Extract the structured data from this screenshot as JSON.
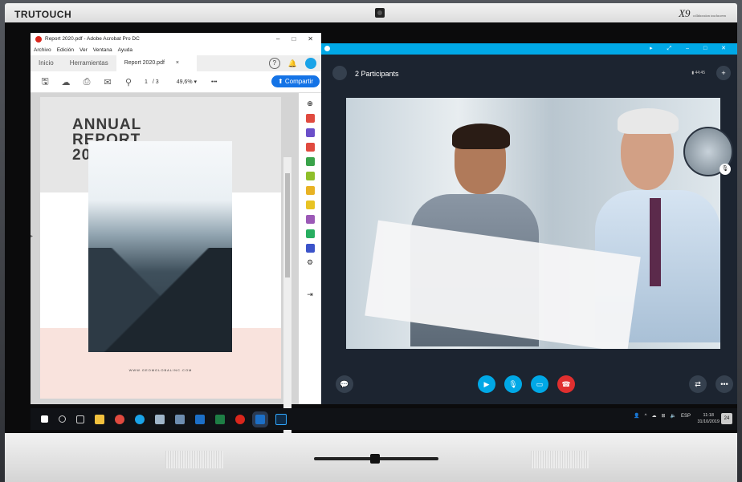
{
  "device": {
    "brand": "TRUTOUCH",
    "model": "X9",
    "model_sub": "collaboration touchscreen"
  },
  "acrobat": {
    "window_title": "Report 2020.pdf - Adobe Acrobat Pro DC",
    "window_controls": [
      "–",
      "□",
      "✕"
    ],
    "menu": [
      "Archivo",
      "Edición",
      "Ver",
      "Ventana",
      "Ayuda"
    ],
    "tabs": [
      "Inicio",
      "Herramientas",
      "Report 2020.pdf"
    ],
    "tab_close": "×",
    "page_current": "1",
    "page_total": "/ 3",
    "zoom": "49,6%",
    "share_label": "Compartir",
    "document": {
      "title_lines": [
        "ANNUAL",
        "REPORT",
        "2020"
      ],
      "website": "WWW.GEOMGLOBALINC.COM"
    }
  },
  "skype": {
    "participants_label": "2 Participants",
    "signal_label": "44:45"
  },
  "taskbar": {
    "language": "ESP",
    "time": "11:18",
    "date": "31/10/2019",
    "notification_count": "24"
  },
  "colors": {
    "skype_blue": "#00a8e6",
    "acrobat_red": "#d9261c",
    "acrobat_blue": "#1473e6",
    "end_call_red": "#e02f2f"
  }
}
